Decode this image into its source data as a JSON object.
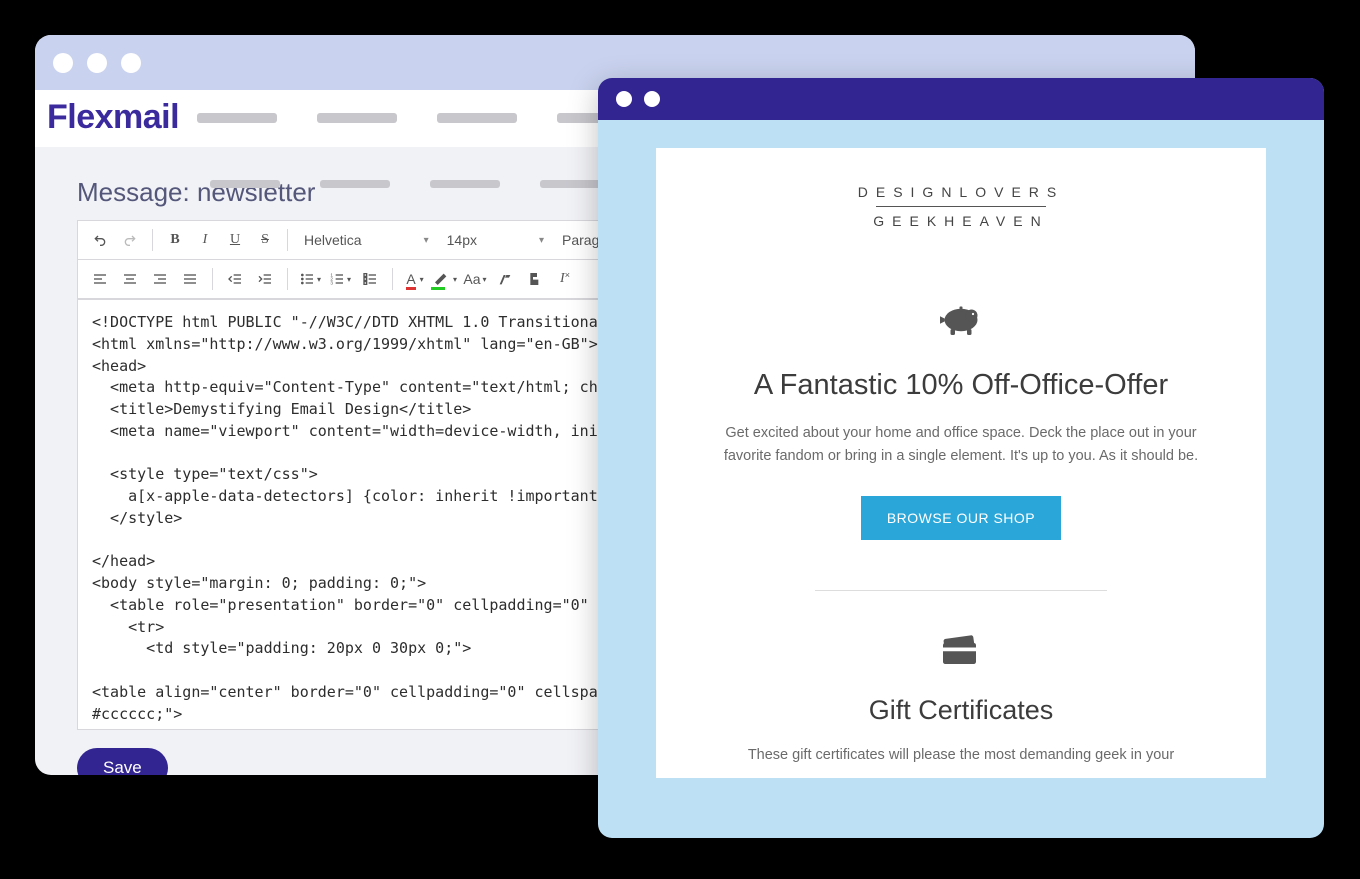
{
  "editor": {
    "brand": "Flexmail",
    "page_title": "Message: newsletter",
    "toolbar": {
      "font_family": "Helvetica",
      "font_size": "14px",
      "format": "Paragraph"
    },
    "code": "<!DOCTYPE html PUBLIC \"-//W3C//DTD XHTML 1.0 Transitional//EN\"\n<html xmlns=\"http://www.w3.org/1999/xhtml\" lang=\"en-GB\">\n<head>\n  <meta http-equiv=\"Content-Type\" content=\"text/html; charset=U\n  <title>Demystifying Email Design</title>\n  <meta name=\"viewport\" content=\"width=device-width, initial-sc\n\n  <style type=\"text/css\">\n    a[x-apple-data-detectors] {color: inherit !important;}\n  </style>\n\n</head>\n<body style=\"margin: 0; padding: 0;\">\n  <table role=\"presentation\" border=\"0\" cellpadding=\"0\" cellsp\n    <tr>\n      <td style=\"padding: 20px 0 30px 0;\">\n\n<table align=\"center\" border=\"0\" cellpadding=\"0\" cellspacing=\"0\n#cccccc;\">\n  <tr>\n    <td align=\"center\" bgcolor=\"#70bbd9\" style=\"padding: 40px 0\n      <img src=\"https://assets.codepen.io/210284/h1_1.gif\" alt=",
    "save_label": "Save"
  },
  "preview": {
    "logo_top": "DESIGNLOVERS",
    "logo_bottom": "GEEKHEAVEN",
    "section1": {
      "headline": "A Fantastic 10% Off-Office-Offer",
      "body": "Get excited about your home and office space.  Deck the place out in your favorite fandom or bring in a single element. It's up to you. As it should be.",
      "cta": "BROWSE OUR SHOP"
    },
    "section2": {
      "headline": "Gift Certificates",
      "body": "These gift certificates will please the most demanding geek in your"
    }
  }
}
